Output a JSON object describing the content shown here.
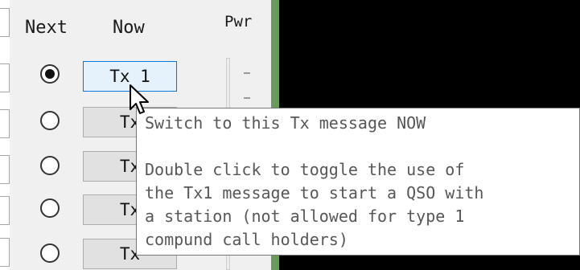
{
  "headers": {
    "next": "Next",
    "now": "Now",
    "pwr": "Pwr"
  },
  "rows": [
    {
      "selected": true,
      "button": "Tx 1",
      "active": true
    },
    {
      "selected": false,
      "button": "Tx",
      "active": false
    },
    {
      "selected": false,
      "button": "Tx",
      "active": false
    },
    {
      "selected": false,
      "button": "Tx",
      "active": false
    },
    {
      "selected": false,
      "button": "Tx",
      "active": false
    }
  ],
  "tooltip": {
    "line1": "Switch to this Tx message NOW",
    "line2": "Double click to toggle the use of",
    "line3": "the Tx1 message to start a QSO with",
    "line4": "a station (not allowed for type 1",
    "line5": "compund call holders)"
  },
  "power_slider": {
    "tick_label": "-"
  },
  "colors": {
    "active_button_bg": "#e5f1fb",
    "active_button_border": "#0078d7",
    "divider_green": "#6a9a5a",
    "display_black": "#000000"
  },
  "icons": {
    "cursor": "arrow-pointer-icon",
    "radio_on": "radio-checked-icon",
    "radio_off": "radio-unchecked-icon"
  }
}
